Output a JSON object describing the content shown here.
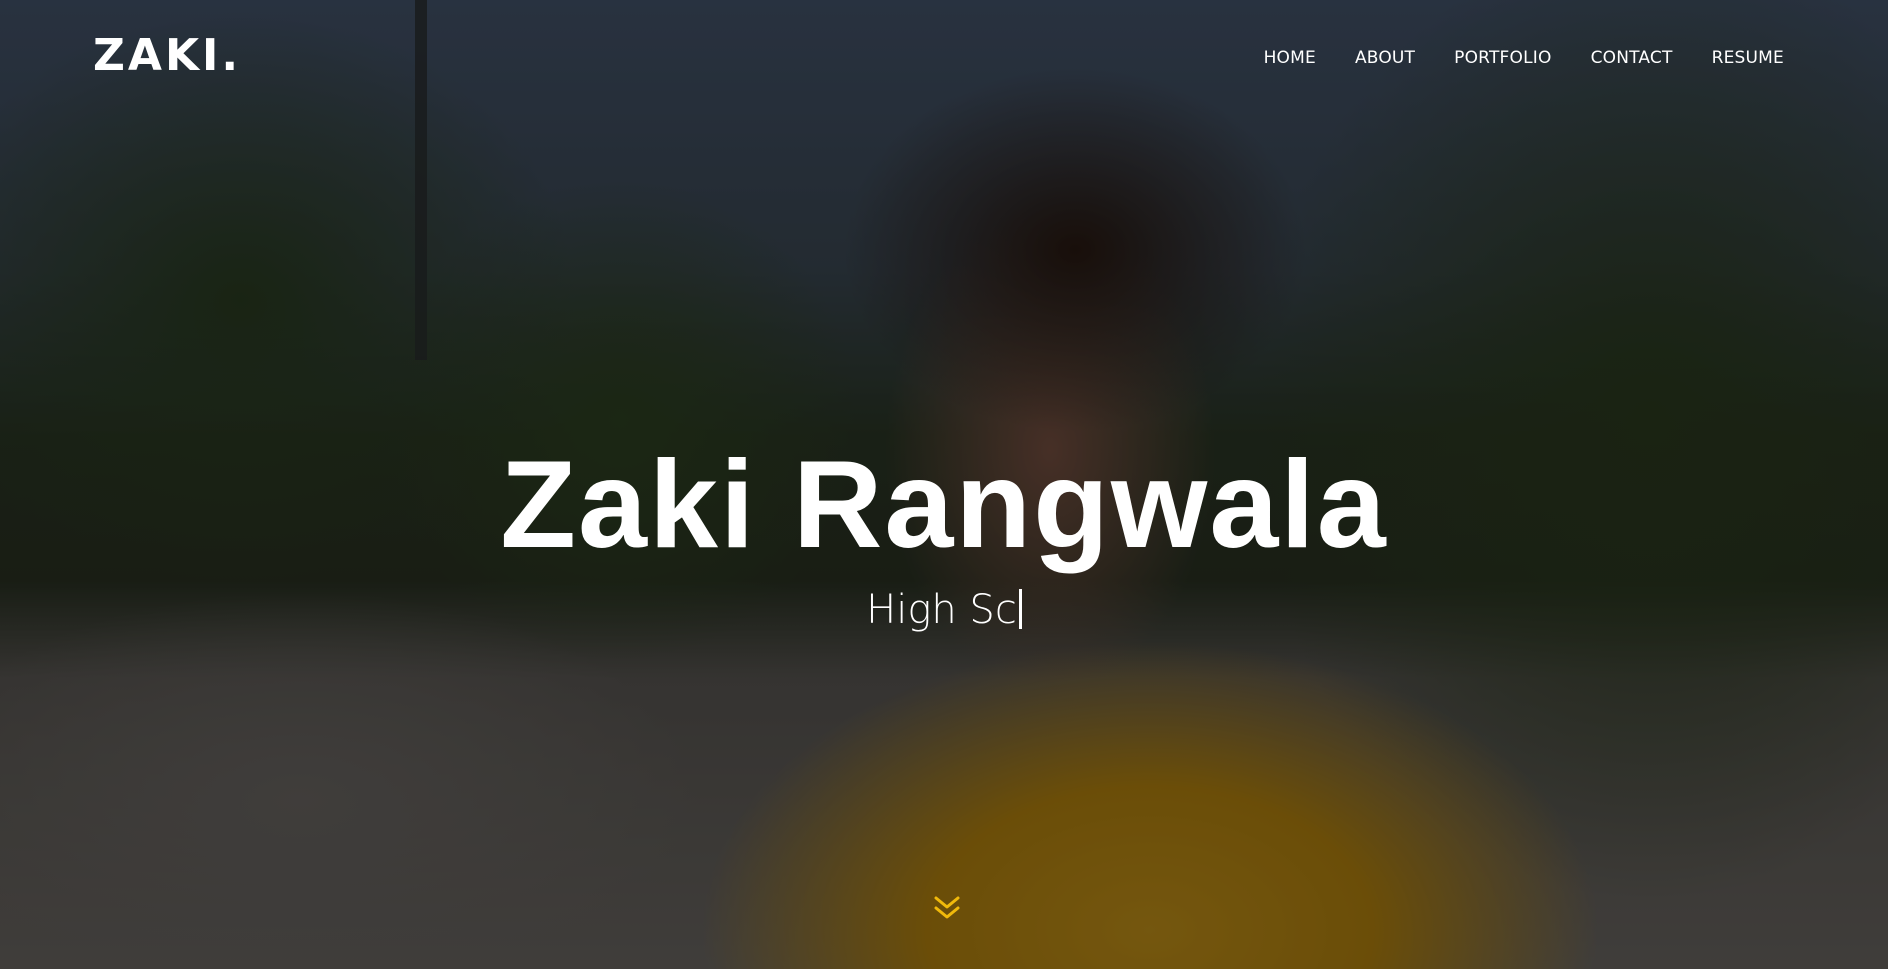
{
  "header": {
    "logo": "ZAKI."
  },
  "nav": {
    "items": [
      {
        "label": "HOME"
      },
      {
        "label": "ABOUT"
      },
      {
        "label": "PORTFOLIO"
      },
      {
        "label": "CONTACT"
      },
      {
        "label": "RESUME"
      }
    ]
  },
  "hero": {
    "name": "Zaki Rangwala",
    "typed_text": "High Sc",
    "scroll_icon": "double-chevron-down-icon",
    "accent_color": "#f0b90b"
  }
}
